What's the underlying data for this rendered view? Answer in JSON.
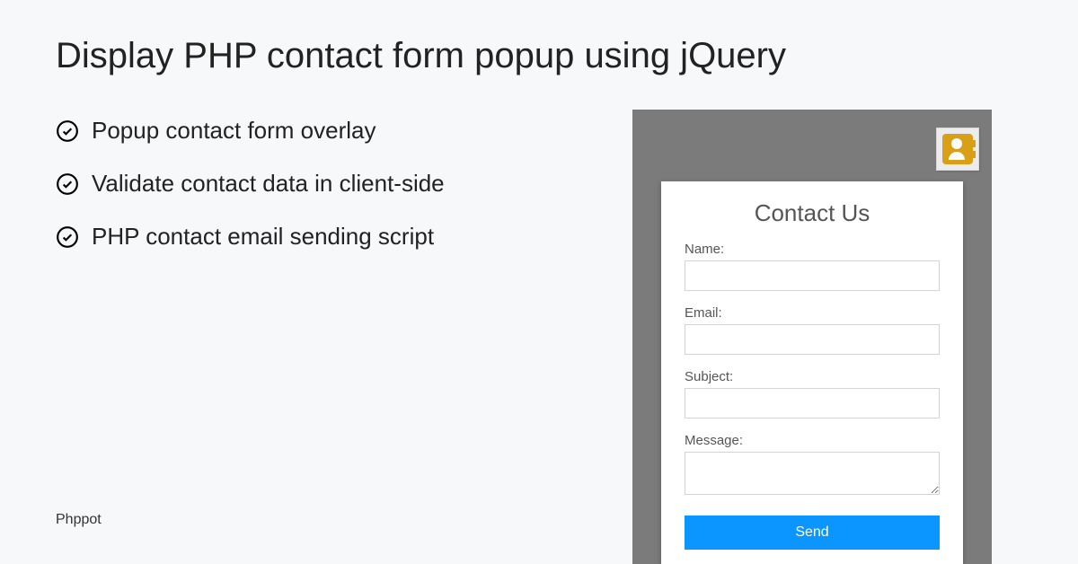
{
  "title": "Display PHP contact form popup using jQuery",
  "bullets": [
    "Popup contact form overlay",
    "Validate contact data in client-side",
    "PHP contact email sending script"
  ],
  "footer": "Phppot",
  "form": {
    "heading": "Contact Us",
    "fields": {
      "name_label": "Name:",
      "email_label": "Email:",
      "subject_label": "Subject:",
      "message_label": "Message:"
    },
    "submit_label": "Send"
  }
}
